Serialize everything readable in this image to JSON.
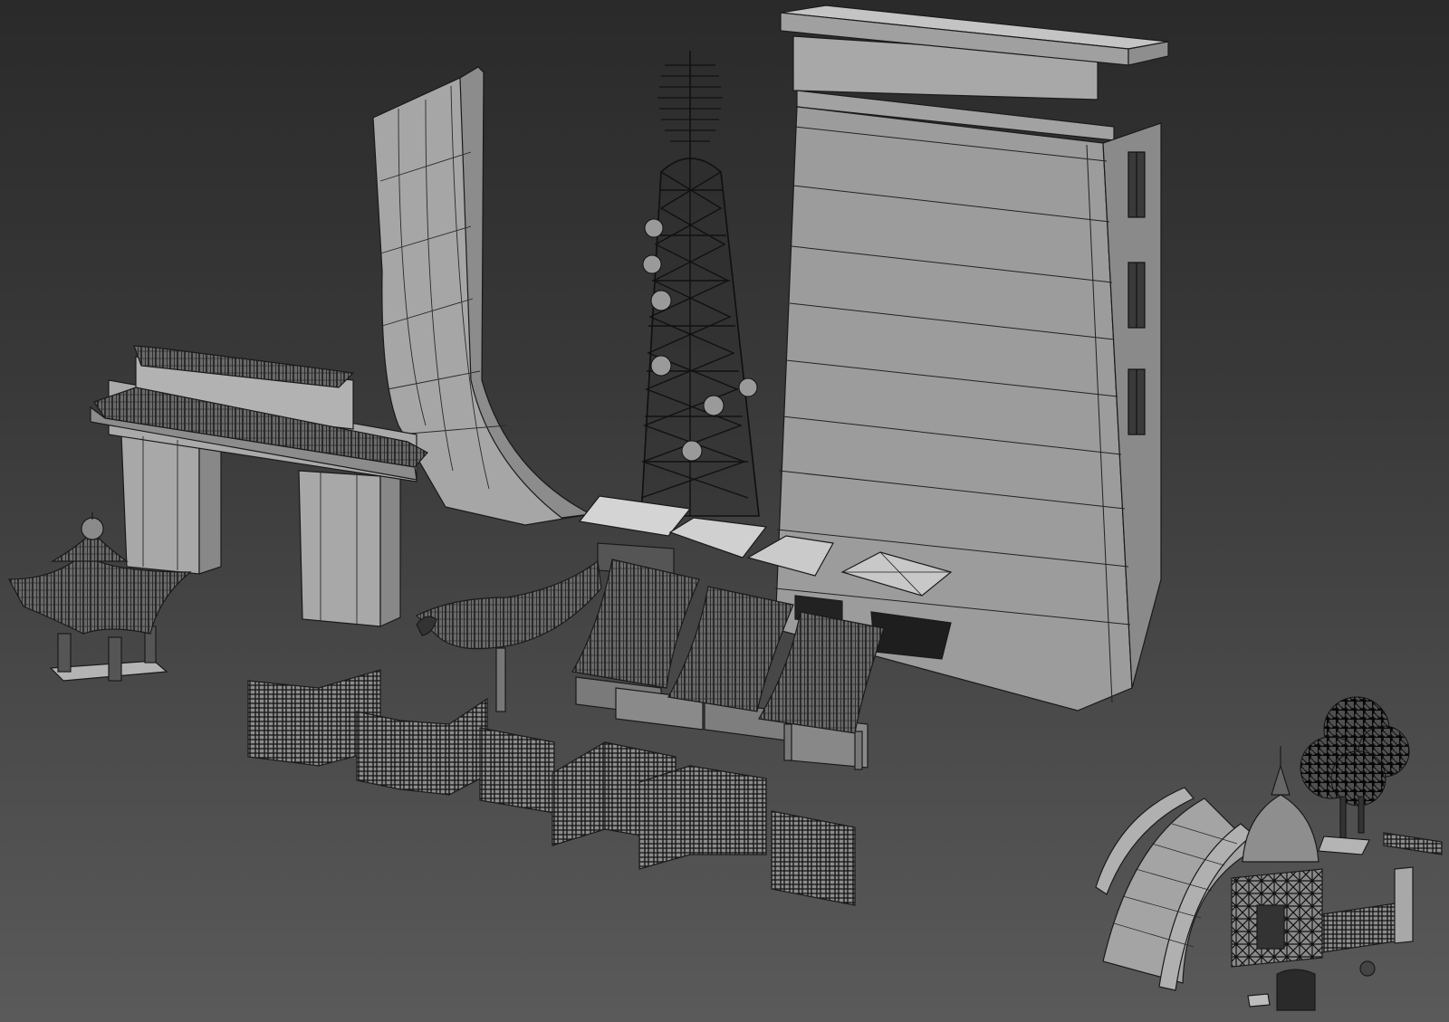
{
  "scene": {
    "background_top": "#2a2a2a",
    "background_bottom": "#5a5a5a",
    "mesh_fill": "#9a9a9a",
    "mesh_fill_light": "#b4b4b4",
    "mesh_fill_dark": "#7e7e7e",
    "wire_color": "#1a1a1a",
    "objects": [
      "tall-building",
      "curved-tower",
      "radio-antenna-tower",
      "chinese-gate",
      "pagoda-pavilion",
      "awning-shops",
      "fence-segments",
      "arched-bridge",
      "stupa-shrine",
      "trees",
      "lantern-post",
      "flat-panels"
    ]
  }
}
